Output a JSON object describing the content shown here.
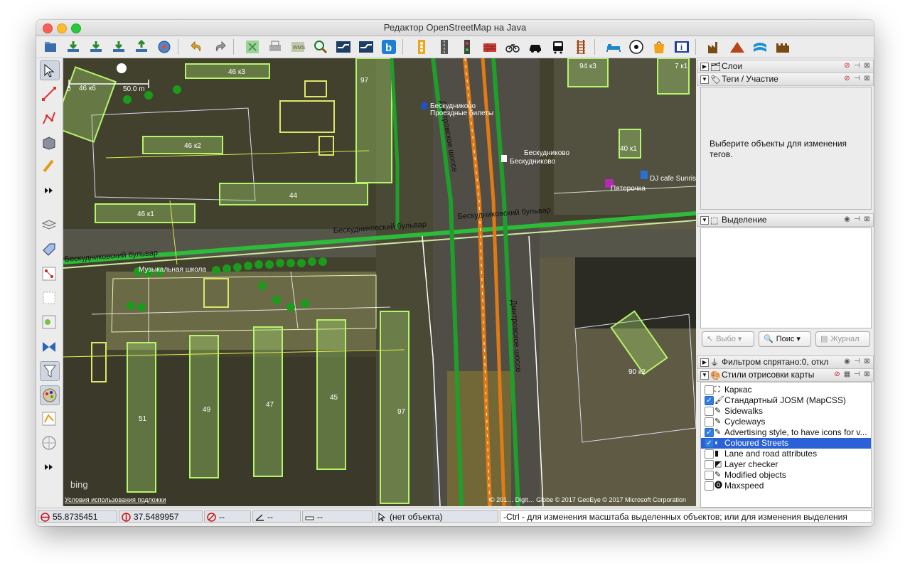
{
  "window": {
    "title": "Редактор OpenStreetMap на Java"
  },
  "toolbar": {
    "icons": [
      "open-icon",
      "download-icon",
      "download-object-icon",
      "download-area-icon",
      "upload-icon",
      "preferences-icon",
      "undo-icon",
      "redo-icon",
      "zoom-fit-icon",
      "print-icon",
      "wms-icon",
      "search-zoom-icon",
      "road-icon",
      "road-alt-icon",
      "bing-icon",
      "traffic-light-icon",
      "road-side-icon",
      "signal-icon",
      "wall-icon",
      "bicycle-icon",
      "car-icon",
      "bus-icon",
      "rail-icon",
      "bed-icon",
      "soccer-icon",
      "shop-icon",
      "info-icon",
      "industry-icon",
      "mountain-icon",
      "water-icon",
      "castle-icon"
    ]
  },
  "left_toolbar": {
    "icons": [
      "select-icon",
      "draw-line-icon",
      "improve-way-icon",
      "building-icon",
      "parallel-icon",
      "more-icon",
      "layers-icon",
      "tags-icon",
      "relations-icon",
      "selection-icon",
      "commands-icon",
      "conflicts-icon",
      "filter-icon",
      "map-style-icon",
      "validator-icon",
      "wiki-icon",
      "more-icon"
    ]
  },
  "map": {
    "scale_zero": "0",
    "scale_label": "50.0 m",
    "attribution_left": "Условия использования подложки",
    "attribution_right": "© 201… Digit… Globe © 2017 GeoEye © 2017 Microsoft Corporation",
    "bing_logo": "bing",
    "building_labels": [
      "46 к3",
      "46 к6",
      "46 к2",
      "44",
      "46 к1",
      "51",
      "49",
      "47",
      "45",
      "94 к3",
      "7 к1",
      "40 к1",
      "90 к2",
      "97",
      "97"
    ],
    "road_labels": [
      "Бескудниковский бульвар",
      "Бескудниковский бульвар",
      "Бескудниковский бульвар",
      "Дмитровское шоссе",
      "Дмитровское шоссе"
    ],
    "poi_labels": [
      "Бескудниково",
      "Проездные билеты",
      "Бескудниково",
      "Бескудниково",
      "Пятерочка",
      "DJ cafe Sunrise",
      "Музыкальная школа"
    ]
  },
  "panels": {
    "layers": {
      "title": "Слои"
    },
    "tags": {
      "title": "Теги / Участие",
      "empty_text": "Выберите объекты для изменения тегов."
    },
    "selection": {
      "title": "Выделение",
      "buttons": {
        "select": "Выбо",
        "search": "Поис",
        "history": "Журнал"
      }
    },
    "filter": {
      "title": "Фильтром спрятано:0, откл"
    },
    "styles": {
      "title": "Стили отрисовки карты",
      "items": [
        {
          "label": "Каркас",
          "checked": false,
          "selected": false
        },
        {
          "label": "Стандартный JOSM (MapCSS)",
          "checked": true,
          "selected": false
        },
        {
          "label": "Sidewalks",
          "checked": false,
          "selected": false
        },
        {
          "label": "Cycleways",
          "checked": false,
          "selected": false
        },
        {
          "label": "Advertising style, to have icons for v...",
          "checked": true,
          "selected": false
        },
        {
          "label": "Coloured Streets",
          "checked": true,
          "selected": true
        },
        {
          "label": "Lane and road attributes",
          "checked": false,
          "selected": false
        },
        {
          "label": "Layer checker",
          "checked": false,
          "selected": false
        },
        {
          "label": "Modified objects",
          "checked": false,
          "selected": false
        },
        {
          "label": "Maxspeed",
          "checked": false,
          "selected": false
        }
      ]
    }
  },
  "status": {
    "lat": "55.8735451",
    "lon": "37.5489957",
    "heading": "--",
    "angle": "--",
    "distance": "--",
    "object": "(нет объекта)",
    "hint": "-Ctrl - для изменения масштаба выделенных объектов; или для изменения выделения"
  },
  "colors": {
    "selection": "#2a61d6",
    "building_outline": "#b5f56a",
    "road_green": "#1f9e2c",
    "road_orange": "#e07a14"
  }
}
